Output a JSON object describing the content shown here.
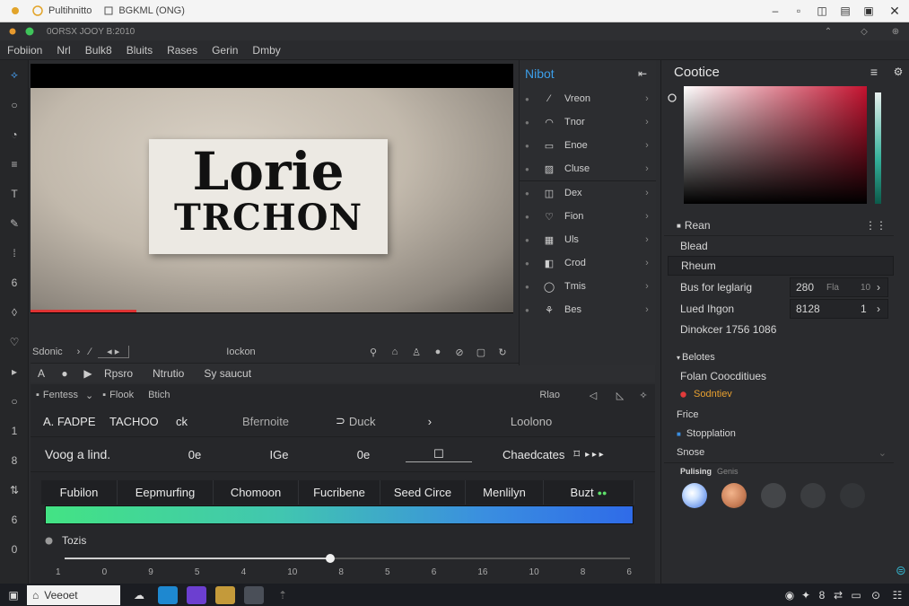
{
  "titlebar": {
    "app_title": "Pultihnitto",
    "doc_title": "BGKML (ONG)"
  },
  "bar2": {
    "text": "0ORSX  JOOY  B:2010"
  },
  "menus": [
    "Fobiion",
    "Nrl",
    "Bulk8",
    "Bluits",
    "Rases",
    "Gerin",
    "Dmby"
  ],
  "tools": [
    "select-icon",
    "circle-icon",
    "gauge-icon",
    "stack-icon",
    "text-icon",
    "pen-icon",
    "line-icon",
    "number-icon",
    "drop-icon",
    "heart-icon",
    "play-icon",
    "radio-icon",
    "one-icon",
    "eight-icon",
    "swap-icon",
    "six-icon",
    "zero-icon"
  ],
  "viewer": {
    "card_line1": "Lorie",
    "card_line2": "TRCHON",
    "left_label": "Sdonic",
    "center_label": "Iockon"
  },
  "tl_toolbar": {
    "b1": "Rpsro",
    "b2": "Ntrutio",
    "b3": "Sy saucut"
  },
  "timeline": {
    "header_a": "Fentess",
    "header_b": "Flook",
    "header_c": "Btich",
    "header_right": "Rlao",
    "row1": [
      "A. FADPE",
      "TACHOO",
      "ck",
      "Bfernoite",
      "Duck",
      "Loolono"
    ],
    "row2": {
      "label": "Voog a lind.",
      "c1": "0e",
      "c2": "IGe",
      "c3": "0e",
      "right": "Chaedcates"
    },
    "buttons": [
      "Fubilon",
      "Eepmurfing",
      "Chomoon",
      "Fucribene",
      "Seed Circe",
      "Menlilyn",
      "Buzt"
    ],
    "track_label": "Tozis",
    "ruler": [
      "1",
      "0",
      "9",
      "5",
      "4",
      "10",
      "8",
      "5",
      "6",
      "16",
      "10",
      "8",
      "6"
    ],
    "playhead_fraction": 0.47
  },
  "midpanel": {
    "title": "Nibot",
    "items": [
      "Vreon",
      "Tnor",
      "Enoe",
      "Cluse",
      "Dex",
      "Fion",
      "Uls",
      "Crod",
      "Tmis",
      "Bes"
    ]
  },
  "rightpanel": {
    "title": "Cootice",
    "section1": "Rean",
    "blend": "Blead",
    "rheum": "Rheum",
    "row_a": {
      "label": "Bus for leglarig",
      "v1": "280",
      "v2": "Fla",
      "v3": "10"
    },
    "row_b": {
      "label": "Lued Ihgon",
      "v1": "8128",
      "v2": "1"
    },
    "row_c": "Dinokcer 1756 1086",
    "section2": "Belotes",
    "cond": "Folan Coocditiues",
    "status": "Sodntiev",
    "frice": "Frice",
    "stopp": "Stopplation",
    "snose": "Snose",
    "sw_label": "Pulising",
    "sw_label2": "Genis"
  },
  "taskbar": {
    "search_text": "Veeoet"
  },
  "colors": {
    "accent": "#3a8ee0",
    "red": "#d33333",
    "status_orange": "#e8a030"
  }
}
